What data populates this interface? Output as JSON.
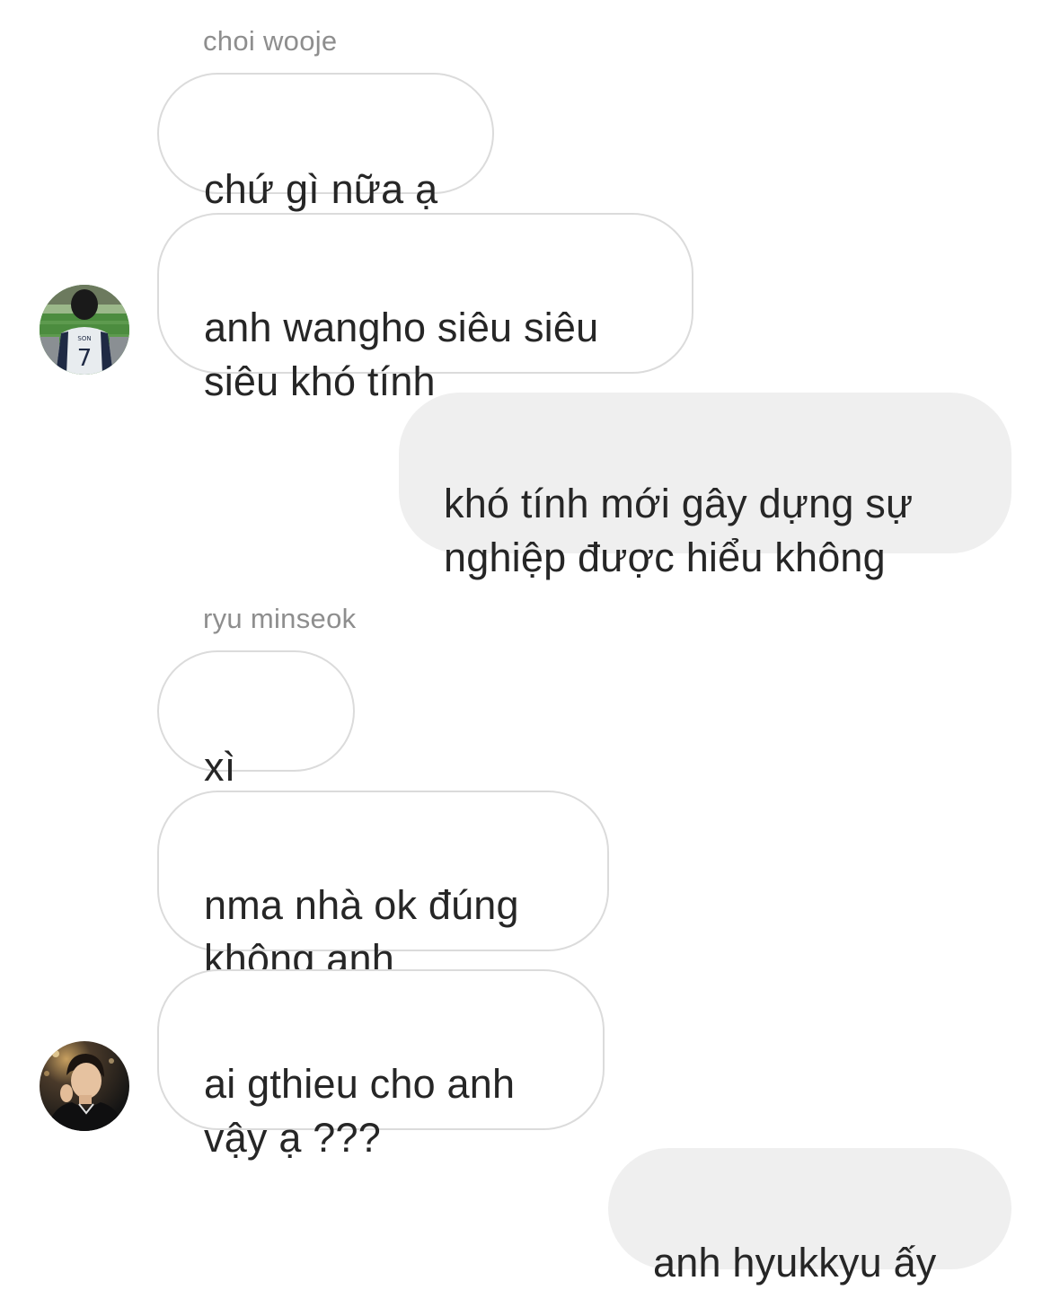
{
  "thread": {
    "groups": [
      {
        "sender": "choi wooje",
        "avatar_icon": "avatar-stadium-fan-icon",
        "messages": [
          "chứ gì nữa ạ",
          "anh wangho siêu siêu\nsiêu khó tính"
        ]
      },
      {
        "sender": "me",
        "messages": [
          "khó tính mới gây dựng sự\nnghiệp được hiểu không"
        ]
      },
      {
        "sender": "ryu minseok",
        "avatar_icon": "avatar-portrait-icon",
        "messages": [
          "xì",
          "nma nhà ok đúng\nkhông anh",
          "ai gthieu cho anh\nvậy ạ ???"
        ],
        "emoji": "face-with-rolling-eyes-icon"
      },
      {
        "sender": "me",
        "messages": [
          "anh hyukkyu ấy"
        ]
      }
    ]
  },
  "colors": {
    "background": "#ffffff",
    "incoming_border": "#dbdbdb",
    "outgoing_fill": "#efefef",
    "sender_name": "#8e8e8e",
    "text": "#262626"
  }
}
